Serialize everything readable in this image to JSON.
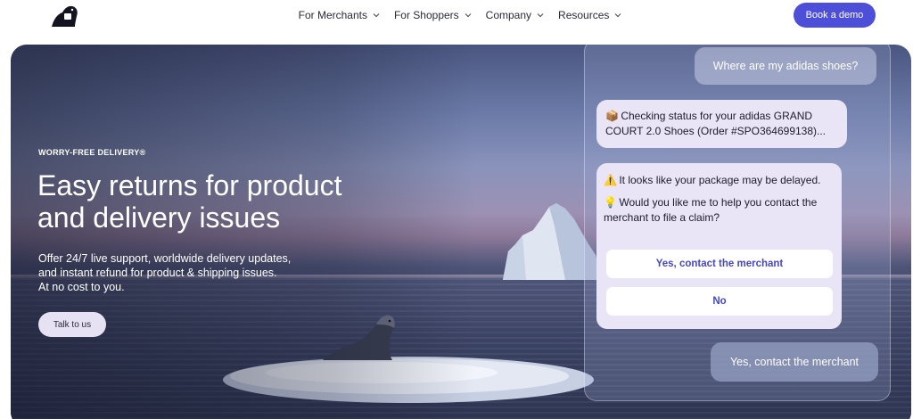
{
  "nav": {
    "logo_icon": "seal-logo-icon",
    "items": [
      {
        "label": "For Merchants"
      },
      {
        "label": "For Shoppers"
      },
      {
        "label": "Company"
      },
      {
        "label": "Resources"
      }
    ],
    "cta_label": "Book a demo",
    "cta_color": "#4d4fd9"
  },
  "hero": {
    "eyebrow": "WORRY-FREE DELIVERY®",
    "headline_line1": "Easy returns for product",
    "headline_line2": "and delivery issues",
    "sub_line1": "Offer 24/7 live support, worldwide delivery updates,",
    "sub_line2": "and instant refund for product & shipping issues.",
    "sub_line3": "At no cost to you.",
    "cta_label": "Talk to us"
  },
  "chat": {
    "user_message_1": "Where are my adidas shoes?",
    "bot_message_1": {
      "emoji": "📦",
      "text": "Checking status for your adidas GRAND COURT 2.0 Shoes (Order #SPO364699138)..."
    },
    "bot_message_2": {
      "line1_emoji": "⚠️",
      "line1": "It looks like your package may be delayed.",
      "line2_emoji": "💡",
      "line2": "Would you like me to help you contact the merchant to file a claim?"
    },
    "options": [
      {
        "label": "Yes, contact the merchant"
      },
      {
        "label": "No"
      }
    ],
    "user_message_2": "Yes, contact the merchant",
    "accent_color": "#4547c8"
  }
}
